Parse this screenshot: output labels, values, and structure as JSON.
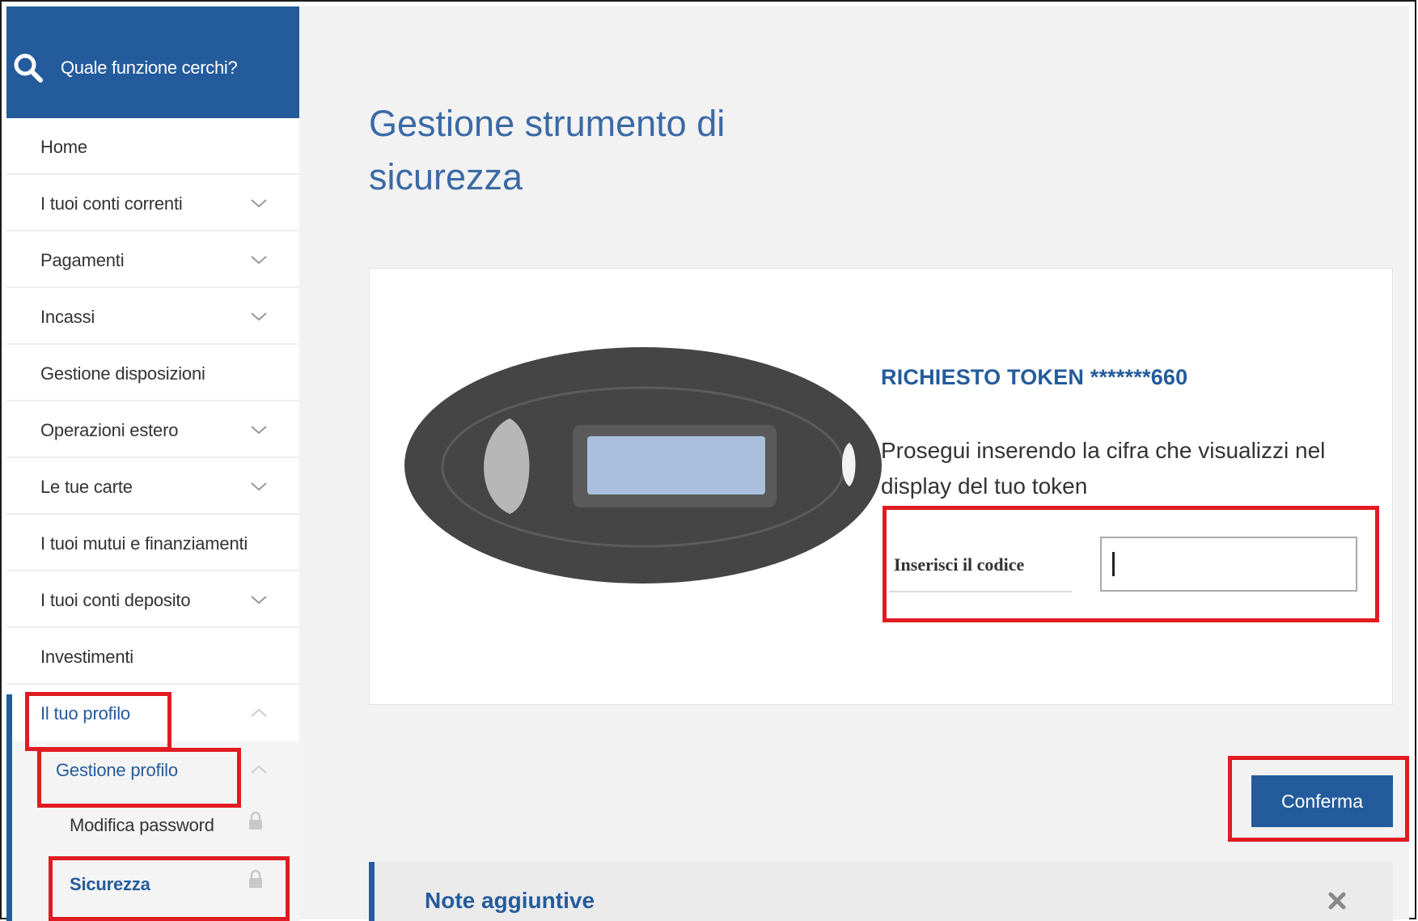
{
  "search": {
    "placeholder": "Quale funzione cerchi?"
  },
  "sidebar": {
    "items": [
      {
        "label": "Home"
      },
      {
        "label": "I tuoi conti correnti"
      },
      {
        "label": "Pagamenti"
      },
      {
        "label": "Incassi"
      },
      {
        "label": "Gestione disposizioni"
      },
      {
        "label": "Operazioni estero"
      },
      {
        "label": "Le tue carte"
      },
      {
        "label": "I tuoi mutui e finanziamenti"
      },
      {
        "label": "I tuoi conti deposito"
      },
      {
        "label": "Investimenti"
      },
      {
        "label": "Il tuo profilo"
      }
    ],
    "submenu": {
      "group_label": "Gestione profilo",
      "items": [
        {
          "label": "Modifica password"
        },
        {
          "label": "Sicurezza"
        }
      ]
    }
  },
  "main": {
    "title": "Gestione strumento di sicurezza",
    "card": {
      "token_title": "RICHIESTO TOKEN *******660",
      "instruction": "Prosegui inserendo la cifra che visualizzi nel display del tuo token",
      "code_label": "Inserisci il codice",
      "code_value": ""
    },
    "confirm_label": "Conferma",
    "notes_title": "Note aggiuntive"
  },
  "colors": {
    "brand": "#245b9c",
    "highlight": "#e11b22"
  },
  "icons": [
    "search-icon",
    "chevron-down-icon",
    "chevron-up-icon",
    "lock-icon",
    "close-icon"
  ]
}
